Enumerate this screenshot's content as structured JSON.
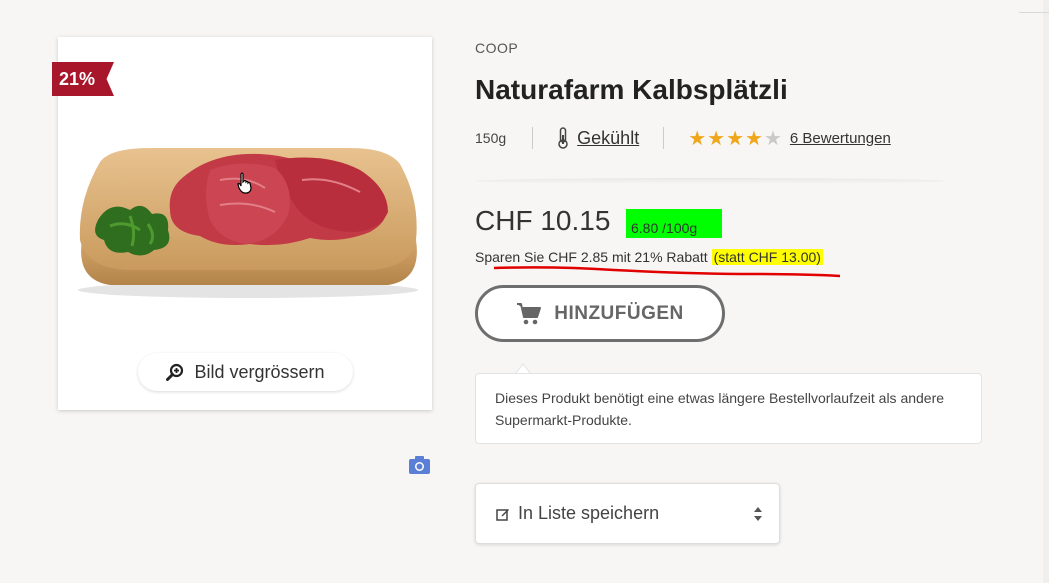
{
  "product": {
    "brand": "COOP",
    "title": "Naturafarm Kalbsplätzli",
    "weight": "150g",
    "storage_label": "Gekühlt",
    "rating": {
      "value": 4,
      "max": 5,
      "reviews_link": "6 Bewertungen"
    },
    "discount_badge": "21%"
  },
  "image": {
    "zoom_label": "Bild vergrössern"
  },
  "pricing": {
    "price": "CHF 10.15",
    "unit_price": "6.80 /100g",
    "savings_text": "Sparen Sie CHF 2.85 mit 21% Rabatt",
    "original_price": "(statt CHF 13.00)"
  },
  "actions": {
    "add_to_cart": "HINZUFÜGEN",
    "save_to_list": "In Liste speichern"
  },
  "notice": {
    "text": "Dieses Produkt benötigt eine etwas längere Bestellvorlaufzeit als andere Supermarkt-Produkte."
  },
  "colors": {
    "badge": "#a8162b",
    "star": "#f0a61a",
    "unit_price_highlight": "#00ff00",
    "old_price_highlight": "#ffff00",
    "annotation_underline": "#e00000"
  },
  "icons": [
    "cart-icon",
    "zoom-icon",
    "thermometer-icon",
    "camera-icon",
    "edit-icon",
    "sort-arrows-icon",
    "hand-cursor-icon"
  ]
}
